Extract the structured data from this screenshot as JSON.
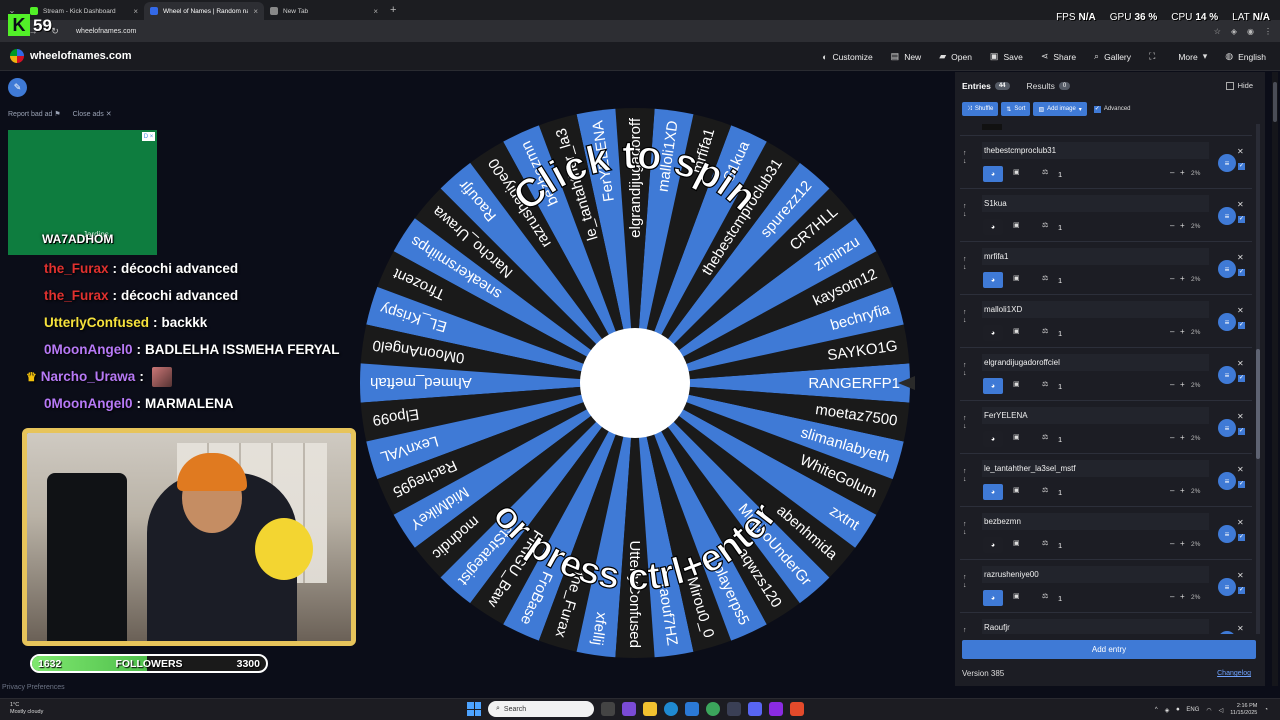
{
  "browser": {
    "tabs": [
      {
        "title": "Stream - Kick Dashboard",
        "favicon_color": "#52f028",
        "active": false
      },
      {
        "title": "Wheel of Names | Random nam",
        "favicon_color": "#3369e8",
        "active": true
      },
      {
        "title": "New Tab",
        "favicon_color": "#888888",
        "active": false
      }
    ],
    "url": "wheelofnames.com"
  },
  "hud": {
    "kick_letter": "K",
    "viewer_count": "59",
    "fps_label": "FPS",
    "fps_value": "N/A",
    "gpu_label": "GPU",
    "gpu_value": "36 %",
    "cpu_label": "CPU",
    "cpu_value": "14 %",
    "lat_label": "LAT",
    "lat_value": "N/A"
  },
  "site": {
    "brand": "wheelofnames.com",
    "menu": [
      {
        "label": "Customize",
        "icon": "palette-icon",
        "glyph": "◐"
      },
      {
        "label": "New",
        "icon": "file-icon",
        "glyph": "▤"
      },
      {
        "label": "Open",
        "icon": "folder-icon",
        "glyph": "▰"
      },
      {
        "label": "Save",
        "icon": "save-icon",
        "glyph": "▣"
      },
      {
        "label": "Share",
        "icon": "share-icon",
        "glyph": "⋖"
      },
      {
        "label": "Gallery",
        "icon": "search-icon",
        "glyph": "⌕"
      },
      {
        "label": "",
        "icon": "fullscreen-icon",
        "glyph": "⛶"
      },
      {
        "label": "More",
        "icon": "chevron-down-icon",
        "glyph": "▾"
      },
      {
        "label": "English",
        "icon": "globe-icon",
        "glyph": "◍"
      }
    ]
  },
  "overlay": {
    "report_ad": "Report bad ad",
    "close_ads": "Close ads",
    "ad_brand": "Jardins",
    "ad_badge": "D ×",
    "name_tag": "WA7ADHOM",
    "chat": [
      {
        "user": "the_Furax",
        "color": "#e0312f",
        "message": "décochi advanced",
        "crown": false,
        "emote": false
      },
      {
        "user": "the_Furax",
        "color": "#e0312f",
        "message": "décochi advanced",
        "crown": false,
        "emote": false
      },
      {
        "user": "UtterlyConfused",
        "color": "#f6e23c",
        "message": "backkk",
        "crown": false,
        "emote": false
      },
      {
        "user": "0MoonAngel0",
        "color": "#b779f6",
        "message": "BADLELHA ISSMEHA FERYAL",
        "crown": false,
        "emote": false
      },
      {
        "user": "Narcho_Urawa",
        "color": "#b779f6",
        "message": "",
        "crown": true,
        "emote": true
      },
      {
        "user": "0MoonAngel0",
        "color": "#b779f6",
        "message": "MARMALENA",
        "crown": false,
        "emote": false
      }
    ],
    "followers_current": "1632",
    "followers_label": "FOLLOWERS",
    "followers_goal": "3300",
    "followers_fraction": 0.49,
    "privacy": "Privacy Preferences"
  },
  "wheel": {
    "spin_text": "Click to spin",
    "ctrl_text": "or press ctrl+enter",
    "colors": [
      "#3f7ad6",
      "#1a1a1a"
    ],
    "names": [
      "RANGERFP1",
      "SAYKO1G",
      "bechryfia",
      "kaysotn12",
      "ziminzu",
      "CR7HLL",
      "spurezz12",
      "thebestcmproclub31",
      "S1kua",
      "mrfifa1",
      "malloli1XD",
      "elgrandijugadoroff",
      "FerYELENA",
      "le_tantahther_la3",
      "bezbezmn",
      "razrusheniye00",
      "Raoufjr",
      "Narcho_Urawa",
      "sneakersmiihps",
      "Tfrozent",
      "EL_Krispy",
      "0MoonAngel0",
      "Ahmed_meftah",
      "Elpo99",
      "LexnVAL",
      "Racheg95",
      "MidMikeY",
      "modndic",
      "stStrategist",
      "FIRIGU_Baw",
      "FroBase",
      "the_Furax",
      "xfellij",
      "UtterlyConfused",
      "raouf7HZ",
      "Mirou0_0",
      "playerps5",
      "aqwzs120",
      "MuchoUnderGr",
      "abenhmida",
      "zxtnt",
      "WhiteGolum",
      "slimanlabyeth",
      "moetaz7500"
    ]
  },
  "panel": {
    "tab_entries": "Entries",
    "entries_count": "44",
    "tab_results": "Results",
    "results_count": "0",
    "hide_label": "Hide",
    "shuffle": "Shuffle",
    "sort": "Sort",
    "add_image": "Add image",
    "advanced": "Advanced",
    "entries": [
      {
        "name": "thebestcmproclub31",
        "weight": "1",
        "percent": "2%",
        "color": "blue"
      },
      {
        "name": "S1kua",
        "weight": "1",
        "percent": "2%",
        "color": "dark"
      },
      {
        "name": "mrfifa1",
        "weight": "1",
        "percent": "2%",
        "color": "blue"
      },
      {
        "name": "malloli1XD",
        "weight": "1",
        "percent": "2%",
        "color": "dark"
      },
      {
        "name": "elgrandijugadoroffciel",
        "weight": "1",
        "percent": "2%",
        "color": "blue"
      },
      {
        "name": "FerYELENA",
        "weight": "1",
        "percent": "2%",
        "color": "dark"
      },
      {
        "name": "le_tantahther_la3sel_mstf",
        "weight": "1",
        "percent": "2%",
        "color": "blue"
      },
      {
        "name": "bezbezmn",
        "weight": "1",
        "percent": "2%",
        "color": "dark"
      },
      {
        "name": "razrusheniye00",
        "weight": "1",
        "percent": "2%",
        "color": "blue"
      },
      {
        "name": "Raoufjr",
        "weight": "1",
        "percent": "2%",
        "color": "dark"
      }
    ],
    "add_entry": "Add entry",
    "version": "Version 385",
    "changelog": "Changelog"
  },
  "taskbar": {
    "weather_temp": "1°C",
    "weather_desc": "Mostly cloudy",
    "search_placeholder": "Search",
    "lang": "ENG",
    "time": "2:16 PM",
    "date": "11/15/2025"
  }
}
